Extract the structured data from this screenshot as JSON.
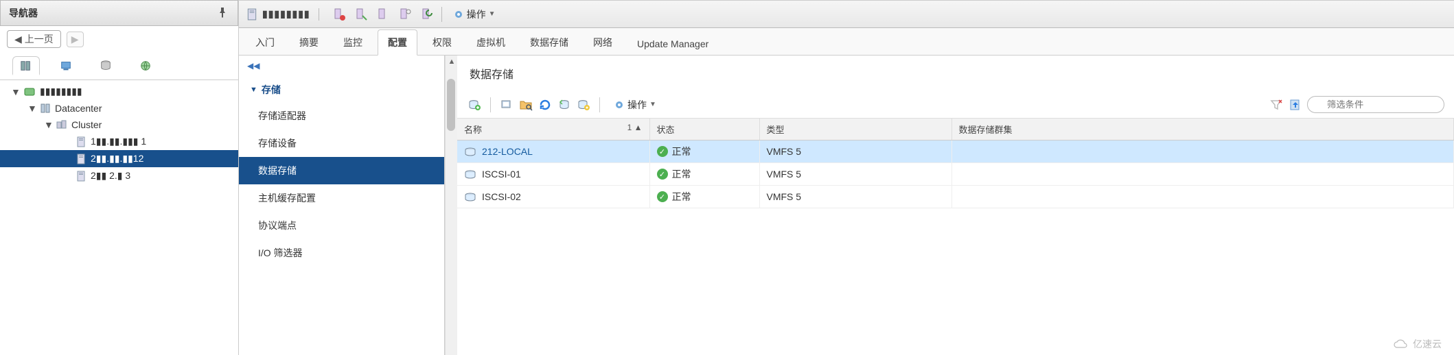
{
  "navigator": {
    "title": "导航器",
    "back_label": "上一页"
  },
  "tree": {
    "root": "▮▮▮▮▮▮▮▮",
    "datacenter": "Datacenter",
    "cluster": "Cluster",
    "hosts": [
      "1▮▮.▮▮.▮▮▮ 1",
      "2▮▮.▮▮.▮▮12",
      "2▮▮   2.▮ 3"
    ]
  },
  "main": {
    "host_label": "▮▮▮▮▮▮▮▮",
    "actions_label": "操作",
    "tabs": [
      "入门",
      "摘要",
      "监控",
      "配置",
      "权限",
      "虚拟机",
      "数据存储",
      "网络",
      "Update Manager"
    ],
    "active_tab": "配置"
  },
  "config": {
    "group_title": "存储",
    "items": [
      "存储适配器",
      "存储设备",
      "数据存储",
      "主机缓存配置",
      "协议端点",
      "I/O 筛选器"
    ],
    "selected": "数据存储"
  },
  "ds": {
    "title": "数据存储",
    "actions_label": "操作",
    "filter_placeholder": "筛选条件",
    "columns": [
      "名称",
      "状态",
      "类型",
      "数据存储群集"
    ],
    "sort_indicator": "1 ▲",
    "rows": [
      {
        "name": "212-LOCAL",
        "status": "正常",
        "type": "VMFS 5",
        "cluster": "",
        "selected": true
      },
      {
        "name": "ISCSI-01",
        "status": "正常",
        "type": "VMFS 5",
        "cluster": "",
        "selected": false
      },
      {
        "name": "ISCSI-02",
        "status": "正常",
        "type": "VMFS 5",
        "cluster": "",
        "selected": false
      }
    ]
  },
  "watermark": "亿速云"
}
